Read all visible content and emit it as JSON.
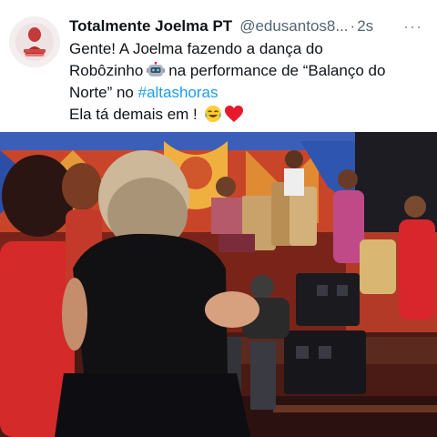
{
  "tweet": {
    "display_name": "Totalmente Joelma PT",
    "handle": "@edusantos8...",
    "separator": "·",
    "time": "2s",
    "more": "···",
    "text": {
      "line1": "Gente! A Joelma fazendo a dança do",
      "line2a": "Robôzinho",
      "line2b": "na performance de “Balanço do",
      "line3a": "Norte” no",
      "hashtag": "#altashoras",
      "line4": "Ela tá demais em !"
    },
    "icons": {
      "robot": "robot-emoji",
      "laugh": "face-with-tears-of-joy-emoji",
      "heart": "red-heart-emoji"
    }
  },
  "media": {
    "description_kind": "video-still",
    "icon": "tv-stage-photo"
  },
  "colors": {
    "name": "#0f1419",
    "secondary": "#536471",
    "link": "#1d9bf0",
    "heart": "#e0245e"
  }
}
